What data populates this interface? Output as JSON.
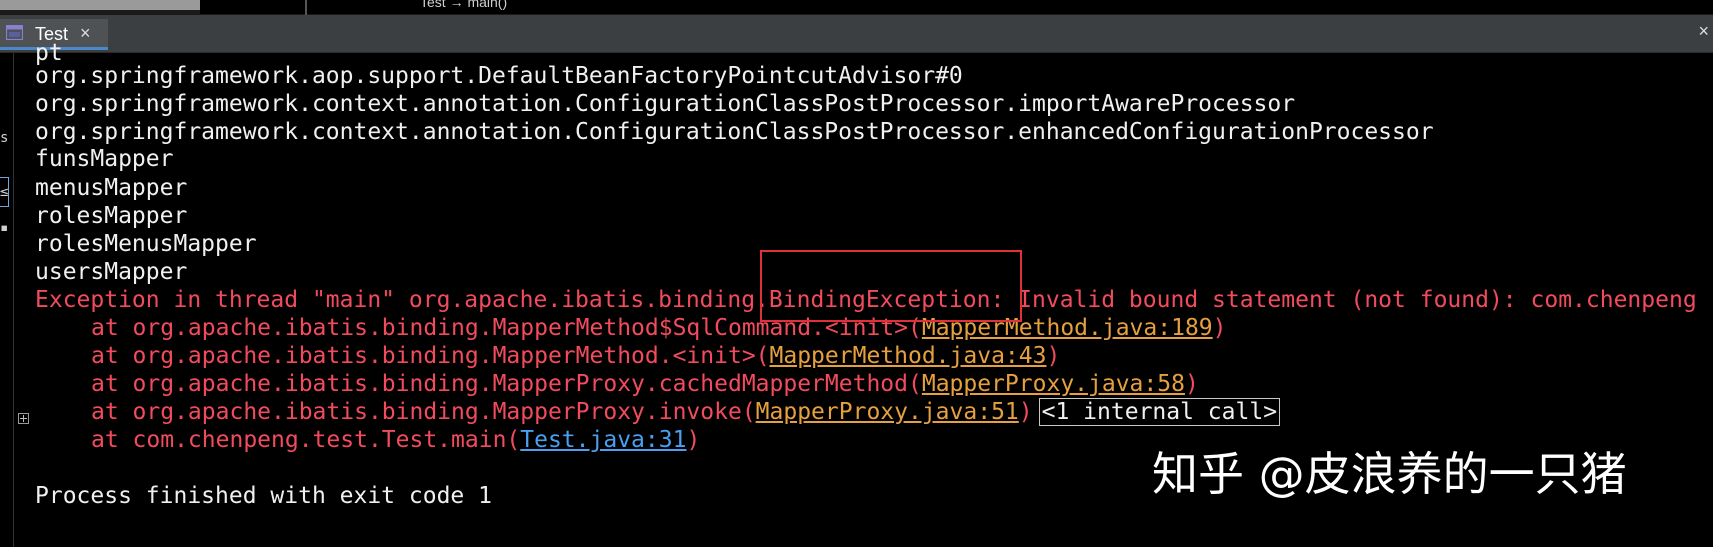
{
  "breadcrumb": {
    "text": "Test → main()"
  },
  "tab": {
    "label": "Test",
    "close": "×"
  },
  "panel": {
    "close": "×"
  },
  "gutter": {
    "frag1": "s",
    "frag2": "≤",
    "frag3": "▪"
  },
  "console": {
    "lines": [
      "pt",
      "org.springframework.aop.support.DefaultBeanFactoryPointcutAdvisor#0",
      "org.springframework.context.annotation.ConfigurationClassPostProcessor.importAwareProcessor",
      "org.springframework.context.annotation.ConfigurationClassPostProcessor.enhancedConfigurationProcessor",
      "funsMapper",
      "menusMapper",
      "rolesMapper",
      "rolesMenusMapper",
      "usersMapper"
    ],
    "exception": "Exception in thread \"main\" org.apache.ibatis.binding.BindingException: Invalid bound statement (not found): com.chenpeng",
    "trace": [
      {
        "prefix": "at org.apache.ibatis.binding.MapperMethod$SqlCommand.<init>(",
        "link": "MapperMethod.java:189",
        "suffix": ")"
      },
      {
        "prefix": "at org.apache.ibatis.binding.MapperMethod.<init>(",
        "link": "MapperMethod.java:43",
        "suffix": ")"
      },
      {
        "prefix": "at org.apache.ibatis.binding.MapperProxy.cachedMapperMethod(",
        "link": "MapperProxy.java:58",
        "suffix": ")"
      },
      {
        "prefix": "at org.apache.ibatis.binding.MapperProxy.invoke(",
        "link": "MapperProxy.java:51",
        "suffix": ")",
        "folded": "<1 internal call>"
      },
      {
        "prefix": "at com.chenpeng.test.Test.main(",
        "link": "Test.java:31",
        "suffix": ")"
      }
    ],
    "exit": "Process finished with exit code 1"
  },
  "watermark": "知乎 @皮浪养的一只猪",
  "colors": {
    "background": "#000000",
    "text": "#f0f0f0",
    "error": "#f24b5d",
    "link": "#e6a03e",
    "link_project": "#4aa0f0",
    "highlight": "#e0303a",
    "tab_underline": "#4a88c7"
  }
}
